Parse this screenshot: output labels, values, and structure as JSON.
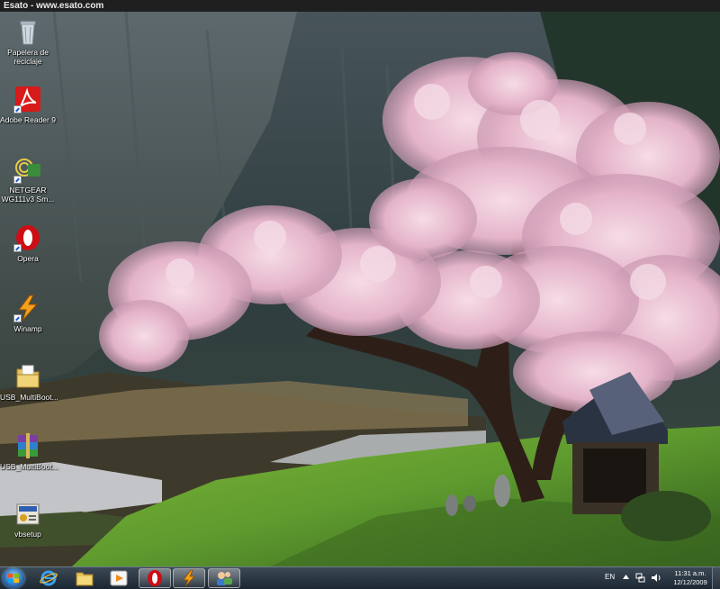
{
  "window": {
    "title": "Esato - www.esato.com"
  },
  "desktop": {
    "icons": [
      {
        "label": "Papelera de reciclaje",
        "icon": "recycle-bin-icon"
      },
      {
        "label": "Adobe Reader 9",
        "icon": "adobe-reader-icon"
      },
      {
        "label": "NETGEAR WG111v3 Sm...",
        "icon": "netgear-icon"
      },
      {
        "label": "Opera",
        "icon": "opera-icon"
      },
      {
        "label": "Winamp",
        "icon": "winamp-icon"
      },
      {
        "label": "USB_MultiBoot...",
        "icon": "folder-icon"
      },
      {
        "label": "USB_MultiBoot...",
        "icon": "winrar-archive-icon"
      },
      {
        "label": "vbsetup",
        "icon": "setup-icon"
      }
    ]
  },
  "taskbar": {
    "pinned": [
      {
        "icon": "internet-explorer-icon"
      },
      {
        "icon": "windows-explorer-icon"
      },
      {
        "icon": "media-player-icon"
      },
      {
        "icon": "opera-icon"
      },
      {
        "icon": "winamp-icon"
      },
      {
        "icon": "network-setup-icon"
      }
    ],
    "tray": {
      "language": "EN",
      "time": "11:31 a.m.",
      "date": "12/12/2009"
    }
  },
  "colors": {
    "taskbar": "#1b2631",
    "opera": "#cc0f16",
    "adobe": "#d71a1a",
    "blossom": "#eac3d6"
  }
}
